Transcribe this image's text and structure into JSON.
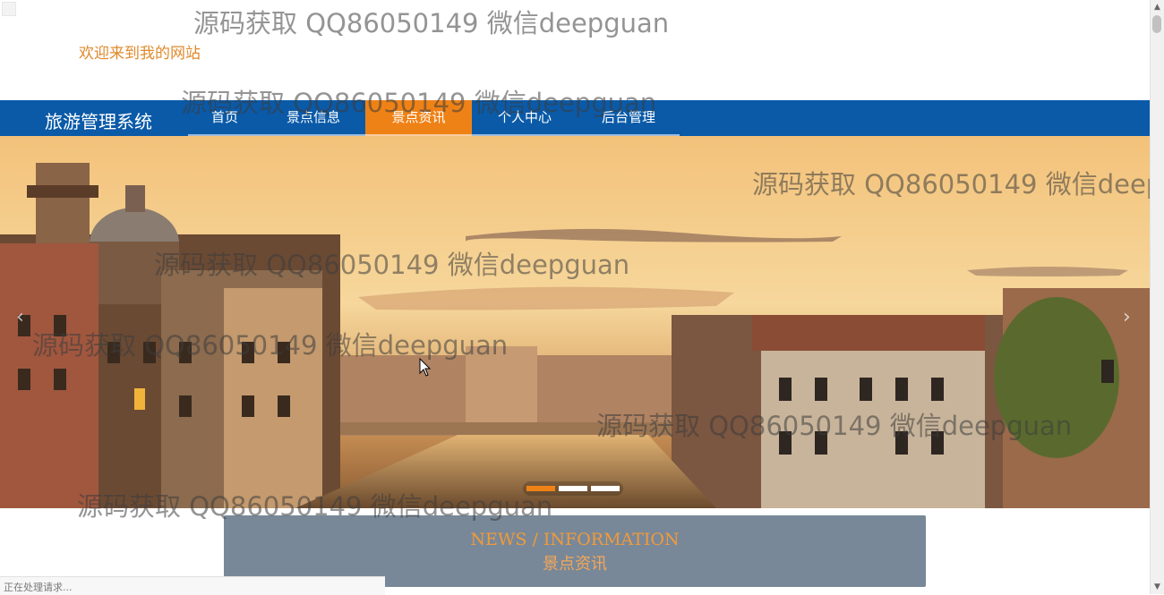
{
  "header": {
    "welcome": "欢迎来到我的网站"
  },
  "navbar": {
    "brand": "旅游管理系统",
    "items": [
      {
        "label": "首页"
      },
      {
        "label": "景点信息"
      },
      {
        "label": "景点资讯"
      },
      {
        "label": "个人中心"
      },
      {
        "label": "后台管理"
      }
    ],
    "active_index": 2
  },
  "banner": {
    "slide_count": 3,
    "active_slide": 0,
    "prev_glyph": "‹",
    "next_glyph": "›"
  },
  "news_section": {
    "title_en": "NEWS / INFORMATION",
    "title_zh": "景点资讯"
  },
  "status_bar": {
    "text": "正在处理请求..."
  },
  "watermark": {
    "text": "源码获取 QQ86050149 微信deepguan"
  },
  "colors": {
    "nav_bg": "#0a5aa8",
    "accent": "#ef8216",
    "news_bg": "#788898"
  }
}
